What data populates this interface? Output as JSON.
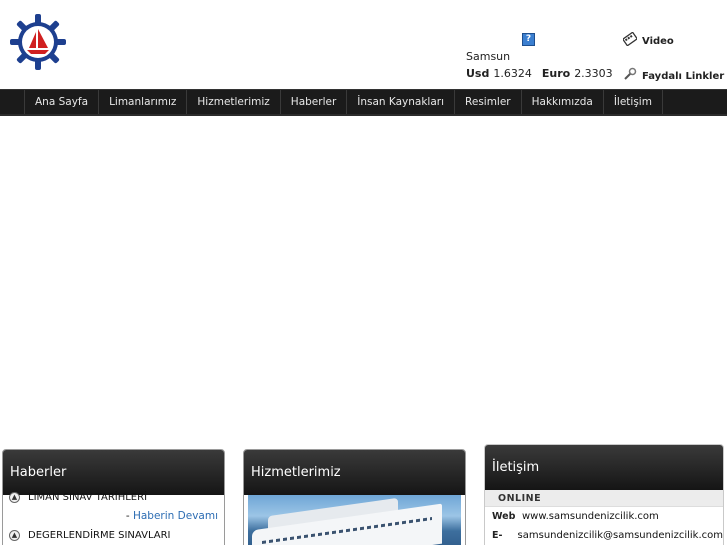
{
  "header": {
    "logo_icon": "ship-wheel-logo-icon",
    "weather_city": "Samsun",
    "weather_icon": "weather-icon",
    "currency": {
      "usd_label": "Usd",
      "usd_value": "1.6324",
      "euro_label": "Euro",
      "euro_value": "2.3303"
    },
    "video_label": "Video",
    "links_label": "Faydalı Linkler"
  },
  "nav": {
    "items": [
      "Ana Sayfa",
      "Limanlarımız",
      "Hizmetlerimiz",
      "Haberler",
      "İnsan Kaynakları",
      "Resimler",
      "Hakkımızda",
      "İletişim"
    ]
  },
  "news": {
    "title": "Haberler",
    "items": [
      "LİMAN SINAV TARİHLERİ",
      "DEGERLENDİRME SINAVLARI"
    ],
    "more_prefix": "- ",
    "more_label": "Haberin Devamı"
  },
  "services": {
    "title": "Hizmetlerimiz"
  },
  "contact": {
    "title": "İletişim",
    "online_label": "ONLINE",
    "web_label": "Web",
    "web_value": "www.samsundenizcilik.com",
    "email_label": "E-",
    "email_value": "samsundenizcilik@samsundenizcilik.com"
  },
  "colors": {
    "nav_bg": "#1b1b1b",
    "panel_head": "#222222",
    "link": "#2d6db3",
    "logo_blue": "#1d3f8f",
    "logo_red": "#d02020"
  }
}
